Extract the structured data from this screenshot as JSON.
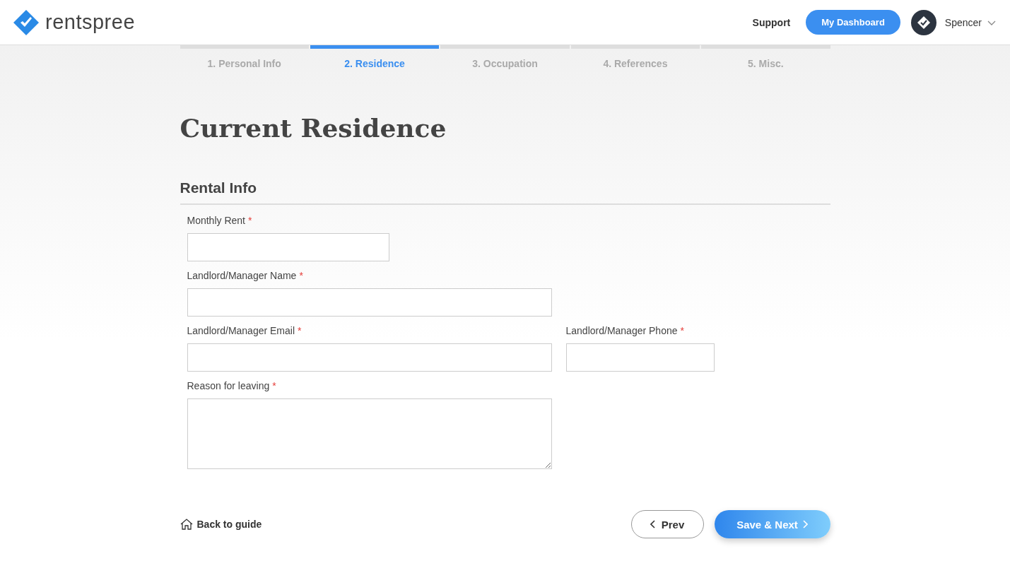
{
  "header": {
    "logo": "rentspree",
    "links": [
      "Support"
    ],
    "dashboard_button": "My Dashboard",
    "user": "Spencer"
  },
  "steps": [
    {
      "label": "1. Personal Info",
      "selected": false
    },
    {
      "label": "2. Residence",
      "selected": true
    },
    {
      "label": "3. Occupation",
      "selected": false
    },
    {
      "label": "4. References",
      "selected": false
    },
    {
      "label": "5. Misc.",
      "selected": false
    }
  ],
  "title": "Current Residence",
  "section": "Rental Info",
  "rows": [
    [
      {
        "label": "Monthly Rent",
        "required_mark": "*",
        "kind": "currency"
      }
    ],
    [
      {
        "label": "Landlord/Manager Name",
        "required_mark": "*",
        "kind": "text"
      }
    ],
    [
      {
        "label": "Landlord/Manager Email",
        "required_mark": "*",
        "kind": "text"
      },
      {
        "label": "Landlord/Manager Phone",
        "required_mark": "*",
        "kind": "phone"
      }
    ],
    [
      {
        "label": "Reason for leaving",
        "required_mark": "*",
        "kind": "textarea"
      }
    ]
  ],
  "footer": {
    "back": "Back to guide",
    "prev": "Prev",
    "next": "Save & Next"
  }
}
